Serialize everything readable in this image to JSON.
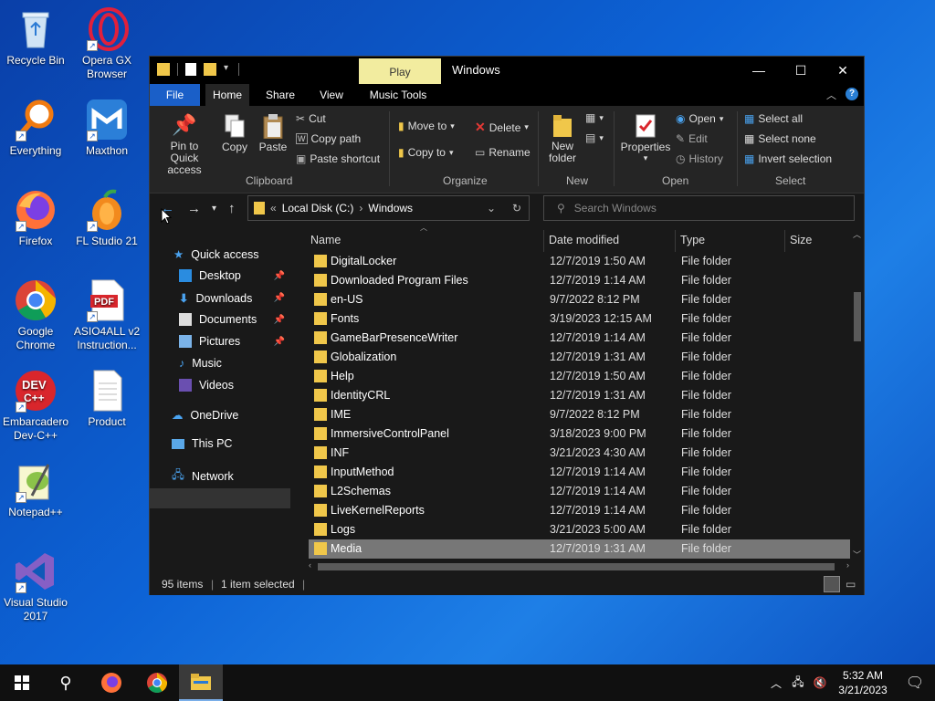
{
  "desktop": {
    "icons": [
      {
        "label": "Recycle Bin"
      },
      {
        "label": "Opera GX Browser"
      },
      {
        "label": "Everything"
      },
      {
        "label": "Maxthon"
      },
      {
        "label": "Firefox"
      },
      {
        "label": "FL Studio 21"
      },
      {
        "label": "Google Chrome"
      },
      {
        "label": "ASIO4ALL v2 Instruction..."
      },
      {
        "label": "Embarcadero Dev-C++"
      },
      {
        "label": "Product"
      },
      {
        "label": "Notepad++"
      },
      {
        "label": "Visual Studio 2017"
      }
    ]
  },
  "window": {
    "title": "Windows",
    "context_tab": "Play",
    "menu_tabs": [
      "File",
      "Home",
      "Share",
      "View",
      "Music Tools"
    ],
    "ribbon": {
      "clipboard": {
        "label": "Clipboard",
        "pin": "Pin to Quick access",
        "copy": "Copy",
        "paste": "Paste",
        "cut": "Cut",
        "copy_path": "Copy path",
        "paste_shortcut": "Paste shortcut"
      },
      "organize": {
        "label": "Organize",
        "move_to": "Move to",
        "copy_to": "Copy to",
        "delete": "Delete",
        "rename": "Rename"
      },
      "new": {
        "label": "New",
        "new_folder": "New folder"
      },
      "open": {
        "label": "Open",
        "properties": "Properties",
        "open": "Open",
        "edit": "Edit",
        "history": "History"
      },
      "select": {
        "label": "Select",
        "select_all": "Select all",
        "select_none": "Select none",
        "invert": "Invert selection"
      }
    },
    "address": {
      "prefix": "«",
      "crumbs": [
        "Local Disk (C:)",
        "Windows"
      ],
      "search_placeholder": "Search Windows"
    },
    "nav": {
      "quick_access": "Quick access",
      "items": [
        "Desktop",
        "Downloads",
        "Documents",
        "Pictures",
        "Music",
        "Videos"
      ],
      "onedrive": "OneDrive",
      "this_pc": "This PC",
      "network": "Network"
    },
    "columns": {
      "name": "Name",
      "date": "Date modified",
      "type": "Type",
      "size": "Size"
    },
    "rows": [
      {
        "name": "DigitalLocker",
        "date": "12/7/2019 1:50 AM",
        "type": "File folder"
      },
      {
        "name": "Downloaded Program Files",
        "date": "12/7/2019 1:14 AM",
        "type": "File folder"
      },
      {
        "name": "en-US",
        "date": "9/7/2022 8:12 PM",
        "type": "File folder"
      },
      {
        "name": "Fonts",
        "date": "3/19/2023 12:15 AM",
        "type": "File folder"
      },
      {
        "name": "GameBarPresenceWriter",
        "date": "12/7/2019 1:14 AM",
        "type": "File folder"
      },
      {
        "name": "Globalization",
        "date": "12/7/2019 1:31 AM",
        "type": "File folder"
      },
      {
        "name": "Help",
        "date": "12/7/2019 1:50 AM",
        "type": "File folder"
      },
      {
        "name": "IdentityCRL",
        "date": "12/7/2019 1:31 AM",
        "type": "File folder"
      },
      {
        "name": "IME",
        "date": "9/7/2022 8:12 PM",
        "type": "File folder"
      },
      {
        "name": "ImmersiveControlPanel",
        "date": "3/18/2023 9:00 PM",
        "type": "File folder"
      },
      {
        "name": "INF",
        "date": "3/21/2023 4:30 AM",
        "type": "File folder"
      },
      {
        "name": "InputMethod",
        "date": "12/7/2019 1:14 AM",
        "type": "File folder"
      },
      {
        "name": "L2Schemas",
        "date": "12/7/2019 1:14 AM",
        "type": "File folder"
      },
      {
        "name": "LiveKernelReports",
        "date": "12/7/2019 1:14 AM",
        "type": "File folder"
      },
      {
        "name": "Logs",
        "date": "3/21/2023 5:00 AM",
        "type": "File folder"
      },
      {
        "name": "Media",
        "date": "12/7/2019 1:31 AM",
        "type": "File folder"
      }
    ],
    "status": {
      "items": "95 items",
      "selected": "1 item selected"
    }
  },
  "taskbar": {
    "time": "5:32 AM",
    "date": "3/21/2023"
  },
  "colors": {
    "accent": "#1a5fc8",
    "folder": "#f0c74a",
    "play_tab": "#f2ec9f"
  }
}
